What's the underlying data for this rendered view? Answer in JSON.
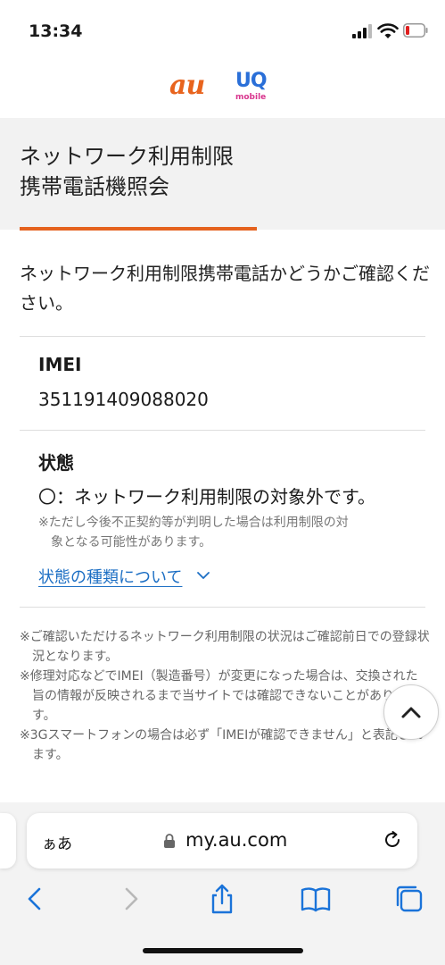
{
  "status_bar": {
    "time": "13:34",
    "icons": [
      "cellular-signal-icon",
      "wifi-icon",
      "battery-low-icon"
    ],
    "battery_color": "#e02020"
  },
  "brand": {
    "au_logo": "au",
    "uq_logo": "UQ",
    "uq_sub": "mobile",
    "au_color": "#e8641e",
    "uq_color": "#2a6fd8",
    "uq_sub_color": "#d8358e"
  },
  "page": {
    "title": "ネットワーク利用制限\n携帯電話機照会",
    "accent_color": "#e5621e",
    "intro": "ネットワーク利用制限携帯電話かどうかご確認ください。"
  },
  "imei": {
    "label": "IMEI",
    "value": "351191409088020"
  },
  "status": {
    "label": "状態",
    "result": "〇：ネットワーク利用制限の対象外です。",
    "note_line1": "※ただし今後不正契約等が判明した場合は利用制限の対",
    "note_line2": "象となる可能性があります。",
    "types_link": "状態の種類について",
    "link_color": "#1d6fc4"
  },
  "footnotes": [
    "※ご確認いただけるネットワーク利用制限の状況はご確認前日での登録状況となります。",
    "※修理対応などでIMEI（製造番号）が変更になった場合は、交換された旨の情報が反映されるまで当サイトでは確認できないことがあります。",
    "※3Gスマートフォンの場合は必ず「IMEIが確認できません」と表記されます。"
  ],
  "browser": {
    "aa_label": "ぁあ",
    "url": "my.au.com",
    "toolbar_icons": [
      "back-icon",
      "forward-icon",
      "share-icon",
      "bookmarks-icon",
      "tabs-icon"
    ],
    "tint_color": "#1a73d9"
  }
}
